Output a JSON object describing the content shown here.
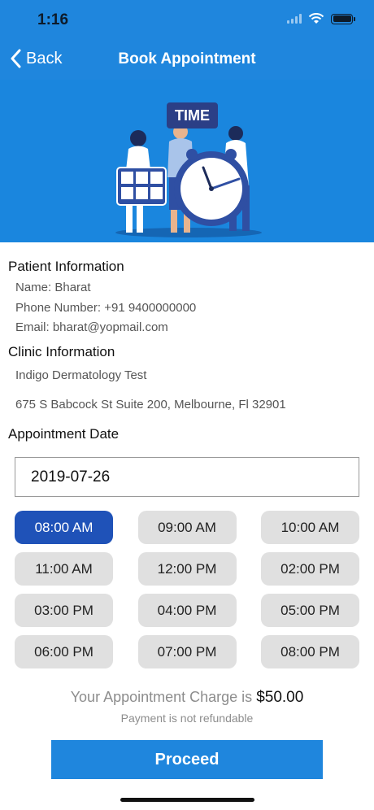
{
  "status_bar": {
    "time": "1:16"
  },
  "nav": {
    "back_label": "Back",
    "title": "Book Appointment"
  },
  "hero": {
    "badge": "TIME"
  },
  "patient": {
    "title": "Patient Information",
    "name": "Name: Bharat",
    "phone": "Phone Number: +91 9400000000",
    "email": "Email: bharat@yopmail.com"
  },
  "clinic": {
    "title": "Clinic Information",
    "name": "Indigo Dermatology Test",
    "address": "675 S Babcock St Suite 200, Melbourne, Fl 32901"
  },
  "appointment": {
    "title": "Appointment Date",
    "date": "2019-07-26",
    "selected_slot": "08:00 AM",
    "slots": [
      "08:00 AM",
      "09:00 AM",
      "10:00 AM",
      "11:00 AM",
      "12:00 PM",
      "02:00 PM",
      "03:00 PM",
      "04:00 PM",
      "05:00 PM",
      "06:00 PM",
      "07:00 PM",
      "08:00 PM"
    ]
  },
  "charge": {
    "label": "Your Appointment Charge is",
    "amount": "$50.00",
    "note": "Payment is not refundable"
  },
  "proceed_label": "Proceed",
  "colors": {
    "primary": "#1f86dd",
    "selected_slot": "#1f52b8",
    "slot_bg": "#e0e0e0"
  }
}
